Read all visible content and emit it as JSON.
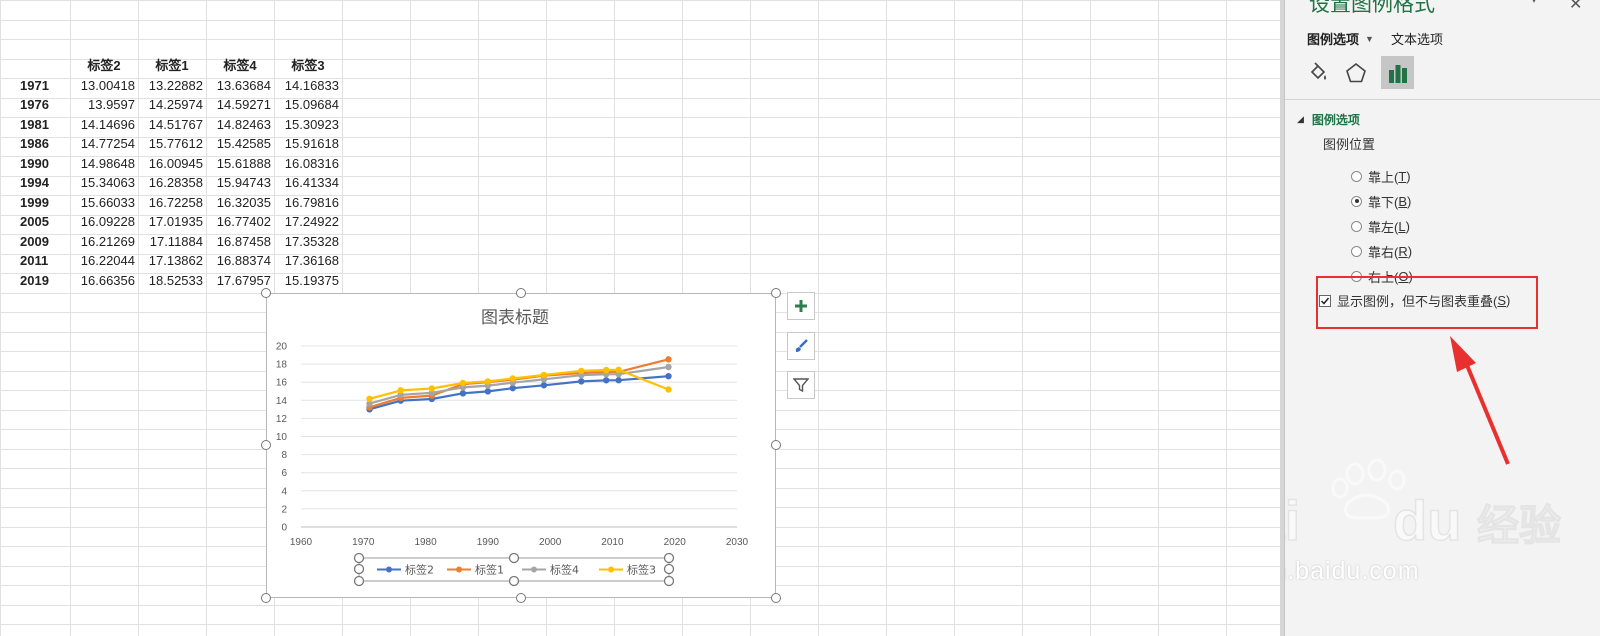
{
  "sheet": {
    "headers": [
      "标签2",
      "标签1",
      "标签4",
      "标签3"
    ],
    "rows": [
      {
        "year": "1971",
        "v": [
          "13.00418",
          "13.22882",
          "13.63684",
          "14.16833"
        ]
      },
      {
        "year": "1976",
        "v": [
          "13.9597",
          "14.25974",
          "14.59271",
          "15.09684"
        ]
      },
      {
        "year": "1981",
        "v": [
          "14.14696",
          "14.51767",
          "14.82463",
          "15.30923"
        ]
      },
      {
        "year": "1986",
        "v": [
          "14.77254",
          "15.77612",
          "15.42585",
          "15.91618"
        ]
      },
      {
        "year": "1990",
        "v": [
          "14.98648",
          "16.00945",
          "15.61888",
          "16.08316"
        ]
      },
      {
        "year": "1994",
        "v": [
          "15.34063",
          "16.28358",
          "15.94743",
          "16.41334"
        ]
      },
      {
        "year": "1999",
        "v": [
          "15.66033",
          "16.72258",
          "16.32035",
          "16.79816"
        ]
      },
      {
        "year": "2005",
        "v": [
          "16.09228",
          "17.01935",
          "16.77402",
          "17.24922"
        ]
      },
      {
        "year": "2009",
        "v": [
          "16.21269",
          "17.11884",
          "16.87458",
          "17.35328"
        ]
      },
      {
        "year": "2011",
        "v": [
          "16.22044",
          "17.13862",
          "16.88374",
          "17.36168"
        ]
      },
      {
        "year": "2019",
        "v": [
          "16.66356",
          "18.52533",
          "17.67957",
          "15.19375"
        ]
      }
    ]
  },
  "chart_data": {
    "type": "line",
    "title": "图表标题",
    "x": [
      1971,
      1976,
      1981,
      1986,
      1990,
      1994,
      1999,
      2005,
      2009,
      2011,
      2019
    ],
    "xlim": [
      1960,
      2030
    ],
    "xticks": [
      1960,
      1970,
      1980,
      1990,
      2000,
      2010,
      2020,
      2030
    ],
    "ylim": [
      0,
      20
    ],
    "yticks": [
      0,
      2,
      4,
      6,
      8,
      10,
      12,
      14,
      16,
      18,
      20
    ],
    "grid": true,
    "legend_position": "bottom",
    "series": [
      {
        "name": "标签2",
        "color": "#4472c4",
        "values": [
          13.00418,
          13.9597,
          14.14696,
          14.77254,
          14.98648,
          15.34063,
          15.66033,
          16.09228,
          16.21269,
          16.22044,
          16.66356
        ]
      },
      {
        "name": "标签1",
        "color": "#ed7d31",
        "values": [
          13.22882,
          14.25974,
          14.51767,
          15.77612,
          16.00945,
          16.28358,
          16.72258,
          17.01935,
          17.11884,
          17.13862,
          18.52533
        ]
      },
      {
        "name": "标签4",
        "color": "#a5a5a5",
        "values": [
          13.63684,
          14.59271,
          14.82463,
          15.42585,
          15.61888,
          15.94743,
          16.32035,
          16.77402,
          16.87458,
          16.88374,
          17.67957
        ]
      },
      {
        "name": "标签3",
        "color": "#ffc000",
        "values": [
          14.16833,
          15.09684,
          15.30923,
          15.91618,
          16.08316,
          16.41334,
          16.79816,
          17.24922,
          17.35328,
          17.36168,
          15.19375
        ]
      }
    ]
  },
  "chart_tools": {
    "add": "plus-icon",
    "style": "brush-icon",
    "filter": "filter-icon"
  },
  "panel": {
    "title": "设置图例格式",
    "tab_legend_options": "图例选项",
    "tab_text_options": "文本选项",
    "section_title": "图例选项",
    "position_label": "图例位置",
    "options": [
      {
        "label": "靠上(",
        "key": "T",
        "end": ")",
        "checked": false
      },
      {
        "label": "靠下(",
        "key": "B",
        "end": ")",
        "checked": true
      },
      {
        "label": "靠左(",
        "key": "L",
        "end": ")",
        "checked": false
      },
      {
        "label": "靠右(",
        "key": "R",
        "end": ")",
        "checked": false
      },
      {
        "label": "右上(",
        "key": "O",
        "end": ")",
        "checked": false
      }
    ],
    "overlap_label": "显示图例，但不与图表重叠(",
    "overlap_key": "S",
    "overlap_end": ")",
    "overlap_checked": true
  },
  "watermark": {
    "brand": "Bai du 经验",
    "url": "jingyan.baidu.com"
  },
  "colors": {
    "accent_green": "#217346",
    "annotation_red": "#e8312f"
  }
}
